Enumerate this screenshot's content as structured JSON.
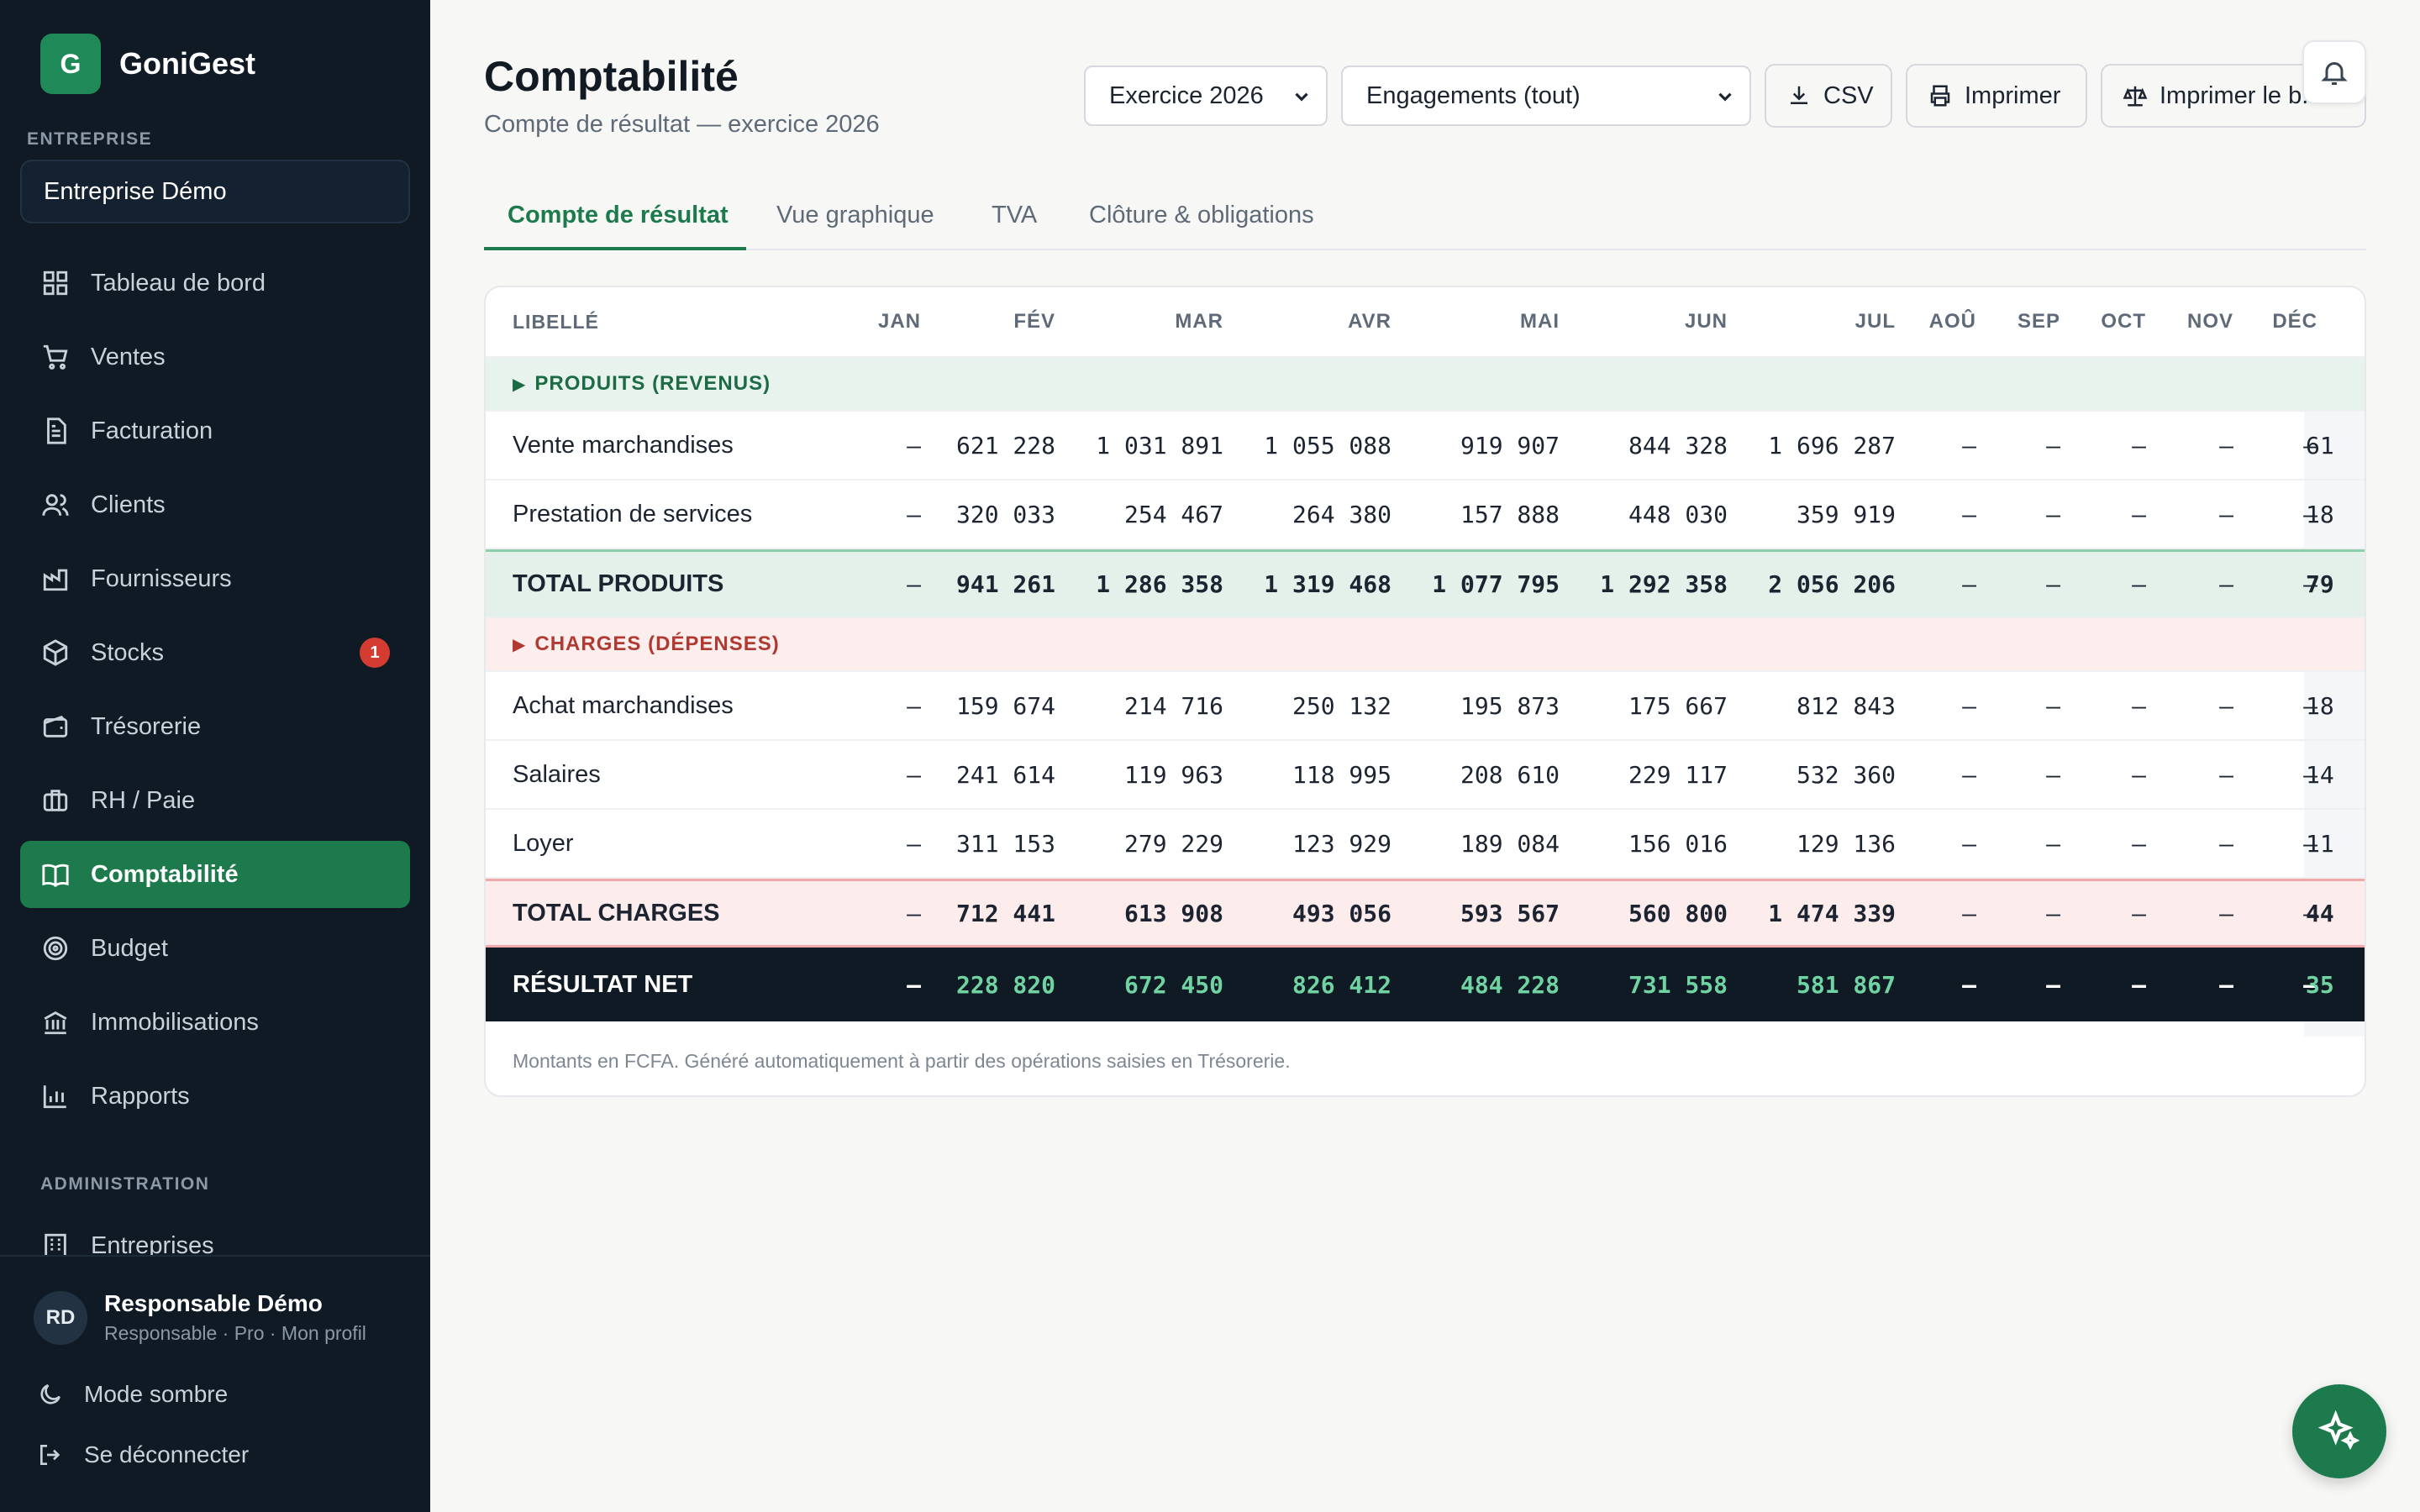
{
  "app": {
    "logo_letter": "G",
    "name": "GoniGest"
  },
  "sidebar": {
    "company_section": "ENTREPRISE",
    "company_name": "Entreprise Démo",
    "items": [
      {
        "label": "Tableau de bord",
        "icon": "dashboard-icon"
      },
      {
        "label": "Ventes",
        "icon": "cart-icon"
      },
      {
        "label": "Facturation",
        "icon": "invoice-icon"
      },
      {
        "label": "Clients",
        "icon": "users-icon"
      },
      {
        "label": "Fournisseurs",
        "icon": "factory-icon"
      },
      {
        "label": "Stocks",
        "icon": "box-icon",
        "badge": "1"
      },
      {
        "label": "Trésorerie",
        "icon": "wallet-icon"
      },
      {
        "label": "RH / Paie",
        "icon": "briefcase-icon"
      },
      {
        "label": "Comptabilité",
        "icon": "book-icon",
        "active": true
      },
      {
        "label": "Budget",
        "icon": "target-icon"
      },
      {
        "label": "Immobilisations",
        "icon": "bank-icon"
      },
      {
        "label": "Rapports",
        "icon": "bar-chart-icon"
      }
    ],
    "admin_section": "ADMINISTRATION",
    "admin_items": [
      {
        "label": "Entreprises",
        "icon": "building-icon"
      }
    ],
    "user": {
      "initials": "RD",
      "name": "Responsable Démo",
      "subtitle": "Responsable · Pro · Mon profil"
    },
    "dark_mode": "Mode sombre",
    "logout": "Se déconnecter"
  },
  "header": {
    "title": "Comptabilité",
    "subtitle": "Compte de résultat — exercice 2026",
    "fiscal_year_select": "Exercice 2026",
    "engagement_select": "Engagements (tout)",
    "csv_label": "CSV",
    "print_label": "Imprimer",
    "print_balance_label": "Imprimer le b..."
  },
  "tabs": [
    "Compte de résultat",
    "Vue graphique",
    "TVA",
    "Clôture & obligations"
  ],
  "table": {
    "columns": [
      "LIBELLÉ",
      "JAN",
      "FÉV",
      "MAR",
      "AVR",
      "MAI",
      "JUN",
      "JUL",
      "AOÛ",
      "SEP",
      "OCT",
      "NOV",
      "DÉC"
    ],
    "section_products": "PRODUITS (REVENUS)",
    "products": [
      {
        "label": "Vente marchandises",
        "values": [
          "—",
          "621 228",
          "1 031 891",
          "1 055 088",
          "919 907",
          "844 328",
          "1 696 287",
          "—",
          "—",
          "—",
          "—",
          "—"
        ],
        "extra": "61"
      },
      {
        "label": "Prestation de services",
        "values": [
          "—",
          "320 033",
          "254 467",
          "264 380",
          "157 888",
          "448 030",
          "359 919",
          "—",
          "—",
          "—",
          "—",
          "—"
        ],
        "extra": "18"
      }
    ],
    "total_products": {
      "label": "TOTAL PRODUITS",
      "values": [
        "—",
        "941 261",
        "1 286 358",
        "1 319 468",
        "1 077 795",
        "1 292 358",
        "2 056 206",
        "—",
        "—",
        "—",
        "—",
        "—"
      ],
      "extra": "79"
    },
    "section_charges": "CHARGES (DÉPENSES)",
    "charges": [
      {
        "label": "Achat marchandises",
        "values": [
          "—",
          "159 674",
          "214 716",
          "250 132",
          "195 873",
          "175 667",
          "812 843",
          "—",
          "—",
          "—",
          "—",
          "—"
        ],
        "extra": "18"
      },
      {
        "label": "Salaires",
        "values": [
          "—",
          "241 614",
          "119 963",
          "118 995",
          "208 610",
          "229 117",
          "532 360",
          "—",
          "—",
          "—",
          "—",
          "—"
        ],
        "extra": "14"
      },
      {
        "label": "Loyer",
        "values": [
          "—",
          "311 153",
          "279 229",
          "123 929",
          "189 084",
          "156 016",
          "129 136",
          "—",
          "—",
          "—",
          "—",
          "—"
        ],
        "extra": "11"
      }
    ],
    "total_charges": {
      "label": "TOTAL CHARGES",
      "values": [
        "—",
        "712 441",
        "613 908",
        "493 056",
        "593 567",
        "560 800",
        "1 474 339",
        "—",
        "—",
        "—",
        "—",
        "—"
      ],
      "extra": "44"
    },
    "net": {
      "label": "RÉSULTAT NET",
      "values": [
        "—",
        "228 820",
        "672 450",
        "826 412",
        "484 228",
        "731 558",
        "581 867",
        "—",
        "—",
        "—",
        "—",
        "—"
      ],
      "extra": "35"
    },
    "footnote": "Montants en FCFA. Généré automatiquement à partir des opérations saisies en Trésorerie."
  },
  "colors": {
    "accent": "#1c7a4c",
    "sidebar_bg": "#0f1a25",
    "positive": "#6fd3a2",
    "danger": "#d43c32"
  }
}
